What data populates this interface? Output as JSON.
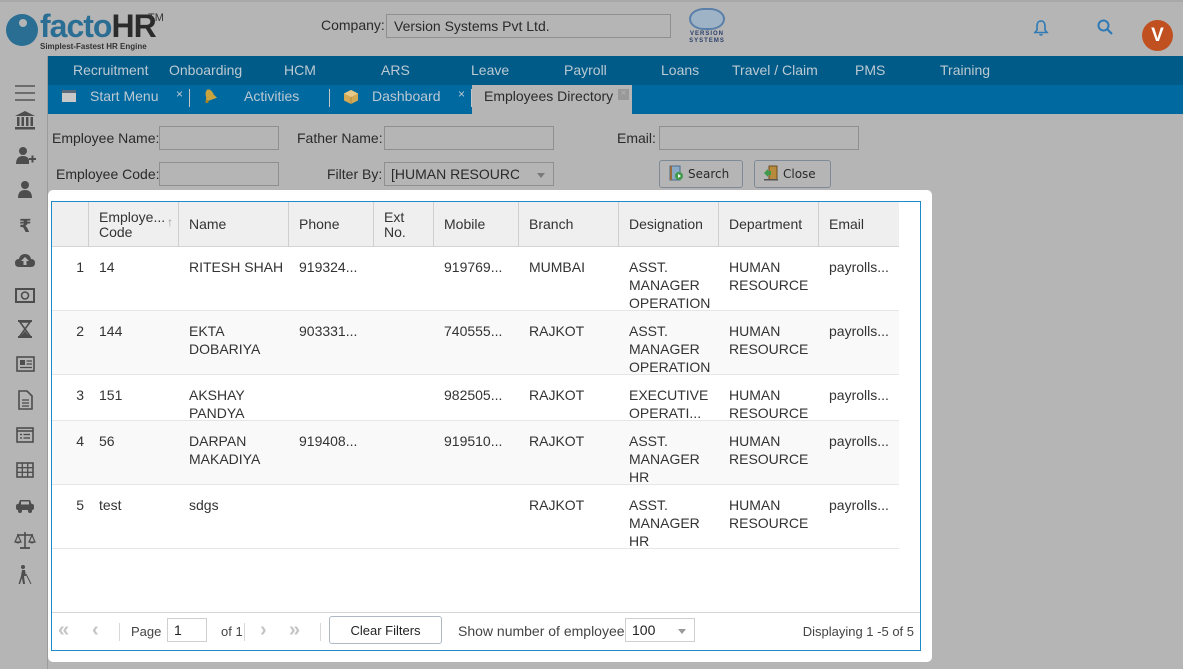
{
  "header": {
    "logo_text_a": "facto",
    "logo_text_b": "HR",
    "logo_tm": "TM",
    "logo_tagline": "Simplest-Fastest HR Engine",
    "company_label": "Company:",
    "company_value": "Version Systems Pvt Ltd.",
    "company_logo_text": "VERSION\nSYSTEMS",
    "avatar_initial": "V",
    "icons": [
      "bell-icon",
      "search-icon"
    ]
  },
  "sidebar": {
    "items": [
      {
        "icon": "menu-icon"
      },
      {
        "icon": "bank-icon"
      },
      {
        "icon": "add-user-icon"
      },
      {
        "icon": "user-icon"
      },
      {
        "icon": "rupee-icon"
      },
      {
        "icon": "cloud-upload-icon"
      },
      {
        "icon": "cash-icon"
      },
      {
        "icon": "hourglass-icon"
      },
      {
        "icon": "newspaper-icon"
      },
      {
        "icon": "document-icon"
      },
      {
        "icon": "list-icon"
      },
      {
        "icon": "table-icon"
      },
      {
        "icon": "car-icon"
      },
      {
        "icon": "balance-scale-icon"
      },
      {
        "icon": "blind-walker-icon"
      }
    ]
  },
  "mainnav": {
    "items": [
      {
        "label": "Recruitment"
      },
      {
        "label": "Onboarding"
      },
      {
        "label": "HCM"
      },
      {
        "label": "ARS"
      },
      {
        "label": "Leave"
      },
      {
        "label": "Payroll"
      },
      {
        "label": "Loans"
      },
      {
        "label": "Travel / Claim"
      },
      {
        "label": "PMS"
      },
      {
        "label": "Training"
      }
    ]
  },
  "tabs": [
    {
      "label": "Start Menu",
      "icon": "window-icon",
      "closable": true
    },
    {
      "label": "Activities",
      "icon": "bell-tab-icon",
      "closable": false
    },
    {
      "label": "Dashboard",
      "icon": "box-icon",
      "closable": true
    },
    {
      "label": "Employees Directory",
      "active": true,
      "closable": true
    }
  ],
  "filters": {
    "employee_name_label": "Employee Name:",
    "employee_name_value": "",
    "father_name_label": "Father Name:",
    "father_name_value": "",
    "email_label": "Email:",
    "email_value": "",
    "employee_code_label": "Employee Code:",
    "employee_code_value": "",
    "filter_by_label": "Filter By:",
    "filter_by_value": "[HUMAN RESOURCE]",
    "search_label": "Search",
    "close_label": "Close"
  },
  "grid": {
    "columns": [
      {
        "label": ""
      },
      {
        "label": "Employe...\nCode",
        "sorted": "asc"
      },
      {
        "label": "Name"
      },
      {
        "label": "Phone"
      },
      {
        "label": "Ext\nNo."
      },
      {
        "label": "Mobile"
      },
      {
        "label": "Branch"
      },
      {
        "label": "Designation"
      },
      {
        "label": "Department"
      },
      {
        "label": "Email"
      }
    ],
    "rows": [
      {
        "n": "1",
        "code": "14",
        "name": "RITESH SHAH",
        "phone": "919324...",
        "ext": "",
        "mobile": "919769...",
        "branch": "MUMBAI",
        "designation": "ASST.\nMANAGER\nOPERATION",
        "department": "HUMAN\nRESOURCE",
        "email": "payrolls..."
      },
      {
        "n": "2",
        "code": "144",
        "name": "EKTA\nDOBARIYA",
        "phone": "903331...",
        "ext": "",
        "mobile": "740555...",
        "branch": "RAJKOT",
        "designation": "ASST.\nMANAGER\nOPERATION",
        "department": "HUMAN\nRESOURCE",
        "email": "payrolls..."
      },
      {
        "n": "3",
        "code": "151",
        "name": "AKSHAY\nPANDYA",
        "phone": "",
        "ext": "",
        "mobile": "982505...",
        "branch": "RAJKOT",
        "designation": "EXECUTIVE\nOPERATI...",
        "department": "HUMAN\nRESOURCE",
        "email": "payrolls..."
      },
      {
        "n": "4",
        "code": "56",
        "name": "DARPAN\nMAKADIYA",
        "phone": "919408...",
        "ext": "",
        "mobile": "919510...",
        "branch": "RAJKOT",
        "designation": "ASST.\nMANAGER\nHR",
        "department": "HUMAN\nRESOURCE",
        "email": "payrolls..."
      },
      {
        "n": "5",
        "code": "test",
        "name": "sdgs",
        "phone": "",
        "ext": "",
        "mobile": "",
        "branch": "RAJKOT",
        "designation": "ASST.\nMANAGER\nHR",
        "department": "HUMAN\nRESOURCE",
        "email": "payrolls..."
      }
    ]
  },
  "pager": {
    "first": "«",
    "prev": "‹",
    "page_label": "Page",
    "page_value": "1",
    "of_label": "of 1",
    "next": "›",
    "last": "»",
    "clear_filters_label": "Clear Filters",
    "show_label": "Show number of employee:",
    "show_value": "100",
    "displaying": "Displaying 1 -5 of 5"
  },
  "colors": {
    "nav_bg": "#005b88",
    "tab_bg": "#0069a0",
    "grid_border": "#1e8ac8",
    "avatar_bg": "#c0501f",
    "brand": "#2a6e94"
  }
}
